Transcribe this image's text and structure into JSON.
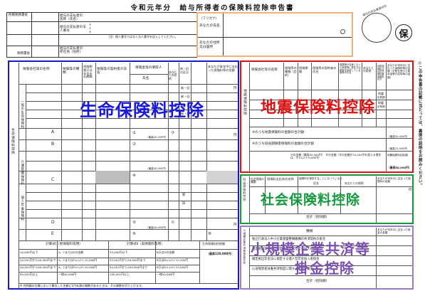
{
  "header": {
    "title": "令和元年分　給与所得者の保険料控除申告書",
    "office_label": "所轄税務署長",
    "tax_office_label": "税務署長",
    "payer_name_label": "給与の支払者の名称（氏名）",
    "payer_number_label": "給与の支払者の法人番号",
    "payer_address_label": "給与の支払者の所在地（住所）",
    "number_note": "（注）個人番号ではなく法人番号を記入してください。",
    "furigana_label": "（フリガナ）",
    "your_name_label": "あなたの氏名",
    "your_address_label": "あなたの住所又は居所",
    "stamp_caption": "給与の支払者受付印",
    "seal_char": "保"
  },
  "side_note": "◎この申告書の記載に当たっては、裏面の説明をお読みください。",
  "sections": {
    "life": {
      "label": "生命保険料控除",
      "color": "#1818e0",
      "column_headers": [
        "保険会社等の名称",
        "保険等の種類",
        "保険期間又は年金支払期間",
        "保険等の契約者の氏名",
        "保険金等の受取人",
        "新・旧の区分",
        "あなたが本年中に支払った保険料等の金額"
      ],
      "recipient_sub": [
        "氏名",
        "あなたとの続柄"
      ],
      "row_group_labels": [
        "一般の生命保険料",
        "介護医療保険料",
        "個人年金保険料"
      ],
      "side_label": "生命保険料控除",
      "letters": [
        "A",
        "B",
        "C",
        "D",
        "E"
      ],
      "circled": [
        "①",
        "②",
        "③",
        "④",
        "⑤",
        "⑥",
        "⑦",
        "⑧"
      ],
      "new_old": [
        "新・旧",
        "新",
        "旧"
      ],
      "yen": "円",
      "max_labels": [
        "（最高40,000円）",
        "（最高40,000円）",
        "（最高40,000円）",
        "（最高120,000円）"
      ],
      "calc_label": "計算式Ⅰ（新保険料等用）",
      "calc_label2": "計算式Ⅱ（旧保険料等用）",
      "total_label": "生命保険料控除額",
      "calc_rows": [
        [
          "20,000円以下",
          "A、CまたはEの金額",
          "25,000円以下",
          "B又はDの金額"
        ],
        [
          "20,001円から40,000円まで",
          "A、CまたはE×1/2＋10,000円",
          "25,001円から50,000円まで",
          "B又はD×1/2＋12,500円"
        ],
        [
          "40,001円から80,000円まで",
          "A、CまたはE×1/4＋20,000円",
          "50,001円から100,000円まで",
          "B又はD×1/4＋25,000円"
        ],
        [
          "80,001円以上",
          "一律40,000円",
          "100,001円以上",
          "一律50,000円"
        ]
      ],
      "footnote": "※ 控除額の計算において算出した金額に1円未満の端数があるときは、その端数を切り上げます。"
    },
    "earthquake": {
      "label": "地震保険料控除",
      "color": "#e01010",
      "column_headers": [
        "保険会社等の名称",
        "保険等の種類（目的）",
        "保険期間",
        "保険等の契約者の氏名",
        "保険等の対象となった家屋等に居住又は家財を利用している者等の氏名",
        "あなたとの続柄",
        "地震保険料又は旧長期損害保険料区分",
        "あなたが本年中に支払った保険料等の金額（分配を受けた剰余金等の控除後の金額）"
      ],
      "lines": [
        "⑨のうち地震保険料の金額の合計額",
        "⑨のうち旧長期損害保険料の金額の合計額"
      ],
      "formula": "Ⓐの金額（最高50,000円）　Ⓑの金額（Ⓑの金額が10,000円を超える場合は、Ⓑ×1/2＋5,000円）",
      "max_labels": [
        "（最高50,000円）",
        "（最高15,000円）",
        "（最高50,000円）"
      ],
      "total_label": "地震保険料控除額",
      "earthquake_tag": "地震",
      "old_tag": "旧長期",
      "side_label": "地震保険料控除"
    },
    "social": {
      "label": "社会保険料控除",
      "color": "#129a3c",
      "column_headers": [
        "社会保険の種類",
        "保険料支払先の名称",
        "保険料を負担することになっている人",
        "あなたが本年中に支払った保険料の金額"
      ],
      "sub_headers": [
        "氏名",
        "あなたとの続柄"
      ],
      "total_label": "合計（控除額）",
      "side_label": "社会保険料控除",
      "yen": "円"
    },
    "small_business": {
      "label_line1": "小規模企業共済等",
      "label_line2": "掛金控除",
      "color": "#8a5fb8",
      "kind_header": "種類",
      "amount_header": "あなたが本年中に支払った掛金の金額",
      "items": [
        "独立行政法人中小企業基盤整備機構の共済契約の掛金",
        "確定拠出年金法に規定する企業型年金加入者掛金",
        "確定拠出年金法に規定する個人型年金加入者掛金",
        "心身障害者扶養共済制度に関する契約の掛金"
      ],
      "total_label": "合計（控除額）",
      "side_label": "小規模企業共済等掛金控除"
    },
    "note_right": "◎この申告書の記載に当たっては、裏面の説明をお読みください。"
  }
}
